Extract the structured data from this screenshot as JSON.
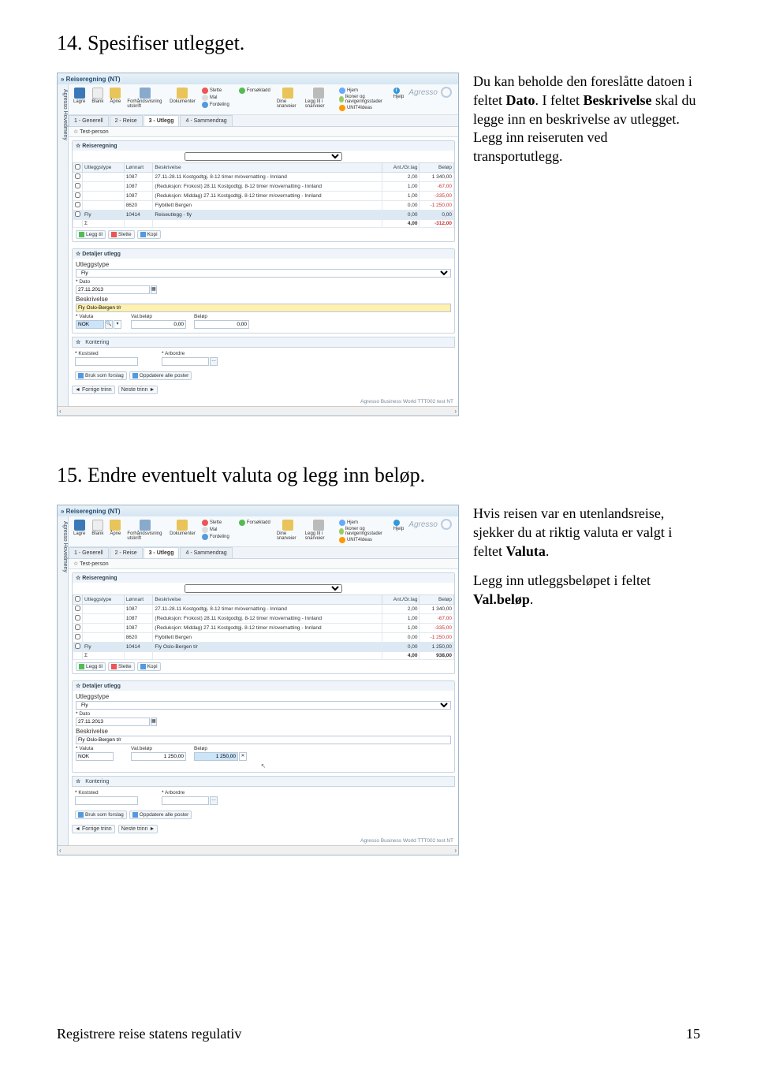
{
  "headings": {
    "step14": "14. Spesifiser utlegget.",
    "step15": "15. Endre eventuelt valuta og legg inn beløp."
  },
  "desc14": {
    "p1a": "Du kan beholde den foreslåtte datoen i feltet ",
    "p1b": "Dato",
    "p1c": ". I feltet ",
    "p1d": "Beskrivelse",
    "p1e": " skal du legge inn en beskrivelse av utlegget. Legg inn reiseruten ved transportutlegg."
  },
  "desc15": {
    "p1a": "Hvis reisen var en utenlandsreise, sjekker du at riktig valuta er valgt i feltet ",
    "p1b": "Valuta",
    "p1c": ".",
    "p2a": "Legg inn utleggsbeløpet i feltet ",
    "p2b": "Val.beløp",
    "p2c": "."
  },
  "app": {
    "title": "Reiseregning (NT)",
    "sidemenu": "Agresso Hovedmeny",
    "brand": "Agresso",
    "toolbar": {
      "lagre": "Lagre",
      "blank": "Blank",
      "apne": "Åpne",
      "forhand": "Forhåndsvisning utskrift",
      "dokumenter": "Dokumenter",
      "slette": "Slette",
      "mal": "Mal",
      "forsokladd": "Forsøkladd",
      "fordeling": "Fordeling",
      "snarveier": "Dine snarveier",
      "leggtil": "Legg til i snarveier",
      "hjem": "Hjem",
      "ikoner": "Ikoner og navigeringsstader",
      "hjelp": "Hjelp",
      "unit": "UNIT4Ideas"
    },
    "tabs": {
      "t1": "1 - Generell",
      "t2": "2 - Reise",
      "t3": "3 - Utlegg",
      "t4": "4 - Sammendrag"
    },
    "sections": {
      "testperson": "Test-person",
      "reiseregning": "Reiseregning",
      "detaljer": "Detaljer utlegg",
      "kontering": "Kontering"
    },
    "gridHeaders": {
      "check": "",
      "utleggstype": "Utleggstype",
      "lonnart": "Lønnart",
      "beskrivelse": "Beskrivelse",
      "ant": "Ant./Gr.lag",
      "belop": "Beløp"
    },
    "rows14": [
      {
        "lonnart": "1087",
        "beskrivelse": "27.11-28.11 Kostgodtgj. 8-12 timer m/overnatting - Innland",
        "ant": "2,00",
        "belop": "1 340,00",
        "neg": false
      },
      {
        "lonnart": "1087",
        "beskrivelse": "(Reduksjon: Frokost) 28.11 Kostgodtgj. 8-12 timer m/overnatting - Innland",
        "ant": "1,00",
        "belop": "-67,00",
        "neg": true
      },
      {
        "lonnart": "1087",
        "beskrivelse": "(Reduksjon: Middag) 27.11 Kostgodtgj. 8-12 timer m/overnatting - Innland",
        "ant": "1,00",
        "belop": "-335,00",
        "neg": true
      },
      {
        "lonnart": "8620",
        "beskrivelse": "Flybillett Bergen",
        "ant": "0,00",
        "belop": "-1 250,00",
        "neg": true
      },
      {
        "lonnart": "10414",
        "beskrivelse": "Reiseutlegg - fly",
        "ant": "0,00",
        "belop": "0,00",
        "neg": false,
        "label": "Fly",
        "blue": true
      }
    ],
    "sum14": {
      "ant": "4,00",
      "belop": "-312,00",
      "neg": true
    },
    "rows15": [
      {
        "lonnart": "1087",
        "beskrivelse": "27.11-28.11 Kostgodtgj. 8-12 timer m/overnatting - Innland",
        "ant": "2,00",
        "belop": "1 340,00",
        "neg": false
      },
      {
        "lonnart": "1087",
        "beskrivelse": "(Reduksjon: Frokost) 28.11 Kostgodtgj. 8-12 timer m/overnatting - Innland",
        "ant": "1,00",
        "belop": "-67,00",
        "neg": true
      },
      {
        "lonnart": "1087",
        "beskrivelse": "(Reduksjon: Middag) 27.11 Kostgodtgj. 8-12 timer m/overnatting - Innland",
        "ant": "1,00",
        "belop": "-335,00",
        "neg": true
      },
      {
        "lonnart": "8620",
        "beskrivelse": "Flybillett Bergen",
        "ant": "0,00",
        "belop": "-1 250,00",
        "neg": true
      },
      {
        "lonnart": "10414",
        "beskrivelse": "Fly Oslo-Bergen t/r",
        "ant": "0,00",
        "belop": "1 250,00",
        "neg": false,
        "label": "Fly",
        "blue": true
      }
    ],
    "sum15": {
      "ant": "4,00",
      "belop": "938,00",
      "neg": false
    },
    "miniBtns": {
      "leggtil": "Legg til",
      "slette": "Slette",
      "kopi": "Kopi"
    },
    "form": {
      "utleggstype": "Utleggstype",
      "utleggstypeVal": "Fly",
      "dato": "Dato",
      "datoVal": "27.11.2013",
      "beskrivelse": "Beskrivelse",
      "beskrivelseVal": "Fly Oslo-Bergen t/r",
      "valuta": "Valuta",
      "valutaVal": "NOK",
      "valbelop": "Val.beløp",
      "valbelopVal14": "0,00",
      "valbelopVal15": "1 250,00",
      "belop": "Beløp",
      "belopVal14": "0,00",
      "belopVal15": "1 250,00",
      "koststed": "Koststed",
      "arbordre": "Arbordre"
    },
    "actionBtns": {
      "forslag": "Bruk som forslag",
      "oppdater": "Oppdatere alle poster"
    },
    "navBtns": {
      "forrige": "Forrige trinn",
      "neste": "Neste trinn"
    },
    "status": "Agresso Business World  TTT002  test  NT"
  },
  "footer": {
    "left": "Registrere reise statens regulativ",
    "right": "15"
  }
}
